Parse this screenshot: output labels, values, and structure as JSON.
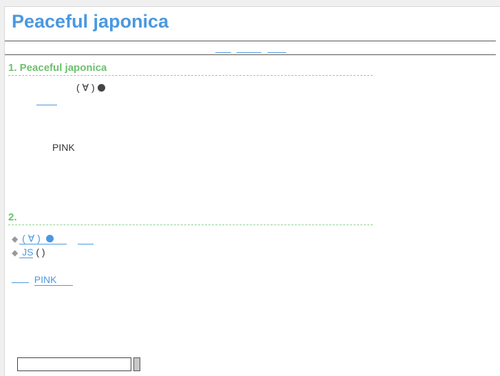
{
  "header": {
    "title": "Peaceful japonica"
  },
  "section1": {
    "heading": "1.  Peaceful japonica",
    "kaomoji": "( ∀ )",
    "pink": "PINK"
  },
  "section2": {
    "heading": "2.",
    "items": [
      {
        "link": " ( ∀ ) "
      },
      {
        "link": "  JS",
        "suffix": " (   )"
      }
    ],
    "pink_link": "PINK"
  }
}
